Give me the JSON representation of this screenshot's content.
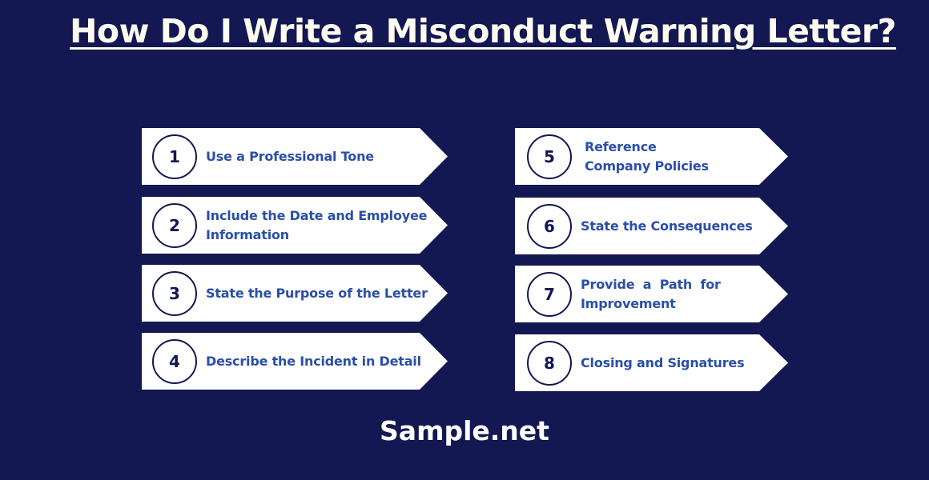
{
  "title": "How Do I Write a Misconduct Warning Letter?",
  "steps": [
    {
      "number": "1",
      "label": "Use a Professional Tone"
    },
    {
      "number": "2",
      "label": "Include the Date and Employee Information"
    },
    {
      "number": "3",
      "label": "State the Purpose of the Letter"
    },
    {
      "number": "4",
      "label": "Describe the Incident in Detail"
    },
    {
      "number": "5",
      "label": "Reference Company Policies"
    },
    {
      "number": "6",
      "label": "State the Consequences"
    },
    {
      "number": "7",
      "label": "Provide a Path for Improvement"
    },
    {
      "number": "8",
      "label": "Closing and Signatures"
    }
  ],
  "footer": "Sample.net",
  "colors": {
    "background": "#131752",
    "card": "#ffffff",
    "step_text": "#2a4fa9",
    "number": "#131752",
    "title": "#fdfbf0"
  }
}
